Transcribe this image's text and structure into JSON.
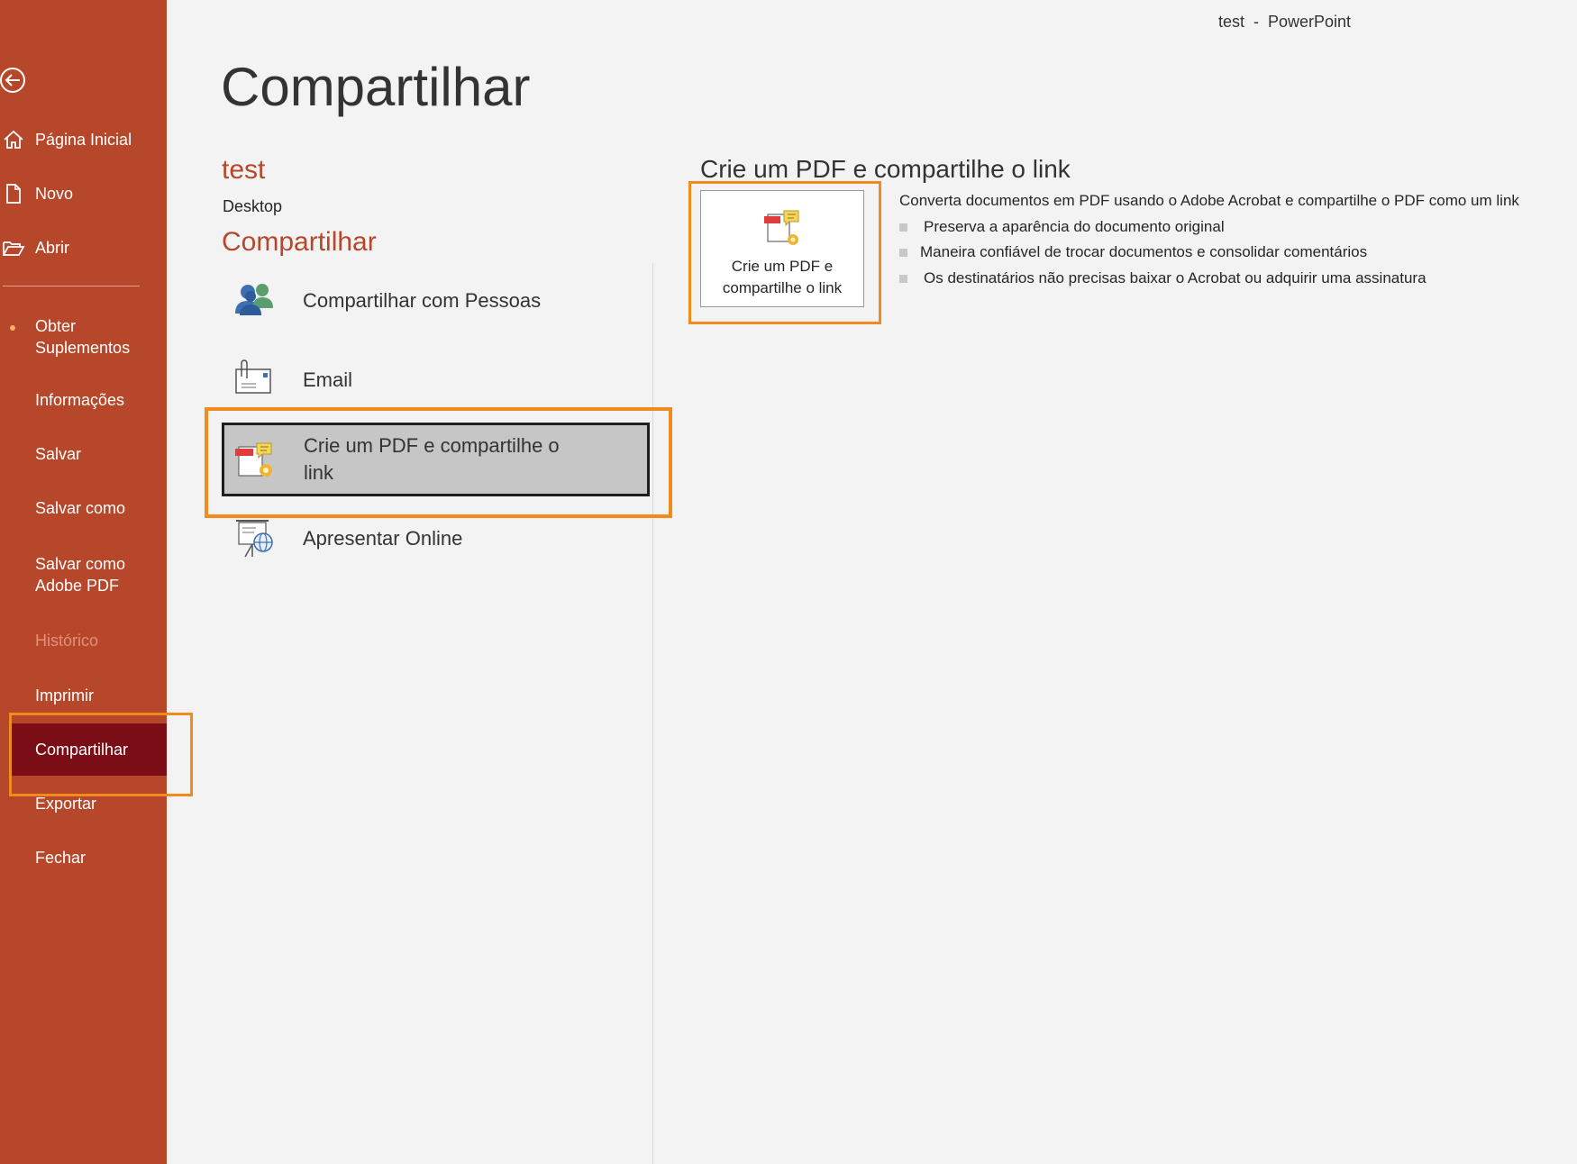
{
  "window": {
    "title": "test  -  PowerPoint"
  },
  "sidebar": {
    "items": [
      {
        "label": "Página Inicial"
      },
      {
        "label": "Novo"
      },
      {
        "label": "Abrir"
      },
      {
        "label": "Obter Suplementos",
        "line1": "Obter",
        "line2": "Suplementos"
      },
      {
        "label": "Informações"
      },
      {
        "label": "Salvar"
      },
      {
        "label": "Salvar como"
      },
      {
        "label": "Salvar como Adobe PDF",
        "line1": "Salvar como",
        "line2": "Adobe PDF"
      },
      {
        "label": "Histórico",
        "disabled": true
      },
      {
        "label": "Imprimir"
      },
      {
        "label": "Compartilhar",
        "selected": true
      },
      {
        "label": "Exportar"
      },
      {
        "label": "Fechar"
      }
    ],
    "colors": {
      "background": "#b7472a",
      "selected": "#7a0d16"
    }
  },
  "page": {
    "title": "Compartilhar",
    "doc_name": "test",
    "doc_location": "Desktop",
    "section_heading": "Compartilhar"
  },
  "share_options": [
    {
      "label": "Compartilhar com Pessoas"
    },
    {
      "label": "Email"
    },
    {
      "label": "Crie um PDF e compartilhe o link",
      "line1": "Crie um PDF e compartilhe o",
      "line2": "link",
      "selected": true
    },
    {
      "label": "Apresentar Online"
    }
  ],
  "panel": {
    "title": "Crie um PDF e compartilhe o link",
    "button_line1": "Crie um PDF e",
    "button_line2": "compartilhe o link",
    "description": "Converta documentos em PDF usando o Adobe Acrobat e compartilhe o PDF como um link",
    "bullets": [
      "Preserva a aparência do documento original",
      "Maneira confiável de trocar documentos e consolidar comentários",
      "Os destinatários não precisas baixar o Acrobat ou adquirir uma assinatura"
    ]
  },
  "highlight_color": "#f28a1c"
}
